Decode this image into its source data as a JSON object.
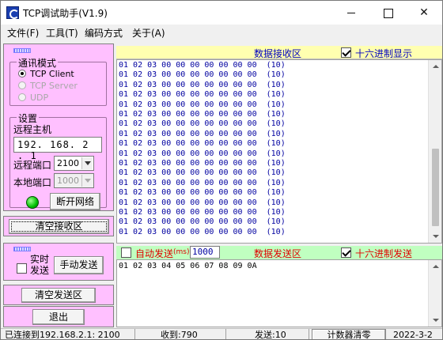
{
  "window": {
    "title": "TCP调试助手(V1.9)",
    "close_glyph": "✕"
  },
  "menu": [
    "文件(F)",
    "工具(T)",
    "编码方式",
    "关于(A)"
  ],
  "settings": {
    "mode_legend": "通讯模式",
    "modes": [
      {
        "label": "TCP Client",
        "checked": true,
        "enabled": true
      },
      {
        "label": "TCP Server",
        "checked": false,
        "enabled": false
      },
      {
        "label": "UDP",
        "checked": false,
        "enabled": false
      }
    ],
    "setup_legend": "设置",
    "remote_host_label": "远程主机",
    "remote_host_value": "192. 168.  2  .  1",
    "remote_port_label": "远程端口",
    "remote_port_value": "2100",
    "local_port_label": "本地端口",
    "local_port_value": "1000",
    "disconnect_button": "断开网络",
    "clear_receive_button": "清空接收区",
    "led_color": "#00c000"
  },
  "send_controls": {
    "timed_send_label": "实时\n发送",
    "timed_send_line1": "实时",
    "timed_send_line2": "发送",
    "manual_send_button": "手动发送",
    "clear_send_button": "清空发送区",
    "exit_button": "退出"
  },
  "receive": {
    "title": "数据接收区",
    "hex_display_label": "十六进制显示",
    "hex_display_checked": true,
    "lines": [
      "01 02 03 00 00 00 00 00 00 00  (10)",
      "01 02 03 00 00 00 00 00 00 00  (10)",
      "01 02 03 00 00 00 00 00 00 00  (10)",
      "01 02 03 00 00 00 00 00 00 00  (10)",
      "01 02 03 00 00 00 00 00 00 00  (10)",
      "01 02 03 00 00 00 00 00 00 00  (10)",
      "01 02 03 00 00 00 00 00 00 00  (10)",
      "01 02 03 00 00 00 00 00 00 00  (10)",
      "01 02 03 00 00 00 00 00 00 00  (10)",
      "01 02 03 00 00 00 00 00 00 00  (10)",
      "01 02 03 00 00 00 00 00 00 00  (10)",
      "01 02 03 00 00 00 00 00 00 00  (10)",
      "01 02 03 00 00 00 00 00 00 00  (10)",
      "01 02 03 00 00 00 00 00 00 00  (10)",
      "01 02 03 00 00 00 00 00 00 00  (10)",
      "01 02 03 00 00 00 00 00 00 00  (10)",
      "01 02 03 00 00 00 00 00 00 00  (10)",
      "01 02 03 00 00 00 00 00 00 00  (10)"
    ]
  },
  "send": {
    "auto_send_label": "自动发送",
    "auto_send_unit": "(ms)",
    "auto_send_checked": false,
    "interval_value": "1000",
    "title": "数据发送区",
    "hex_send_label": "十六进制发送",
    "hex_send_checked": true,
    "content": "01 02 03 04 05 06 07 08 09 0A"
  },
  "status": {
    "connected": "已连接到192.168.2.1:  2100",
    "received": "收到:790",
    "sent": "发送:10",
    "reset_counter_button": "计数器清零",
    "date": "2022-3-2"
  }
}
